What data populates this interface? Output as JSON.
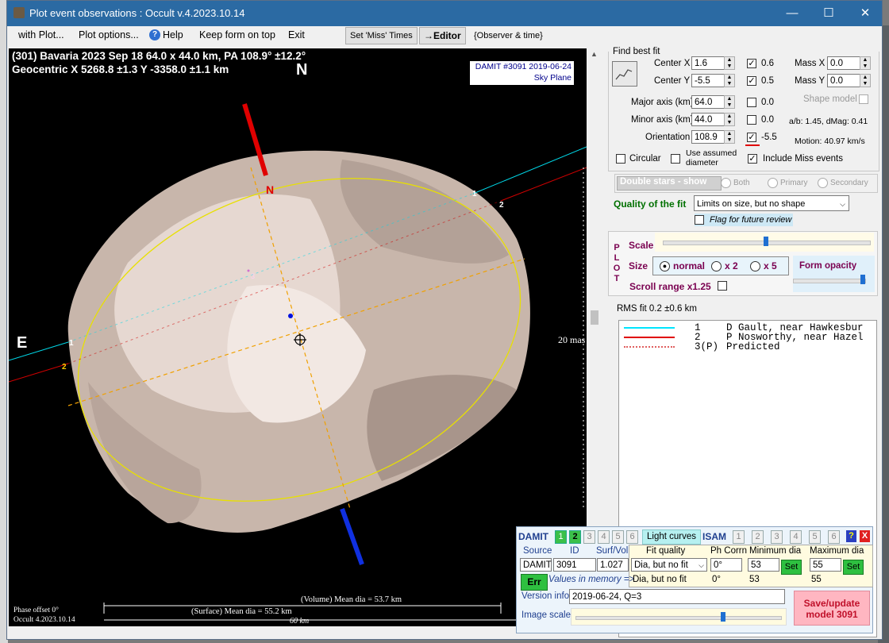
{
  "window": {
    "title": "Plot event observations : Occult v.4.2023.10.14",
    "buttons": {
      "minimize": "—",
      "maximize": "☐",
      "close": "✕"
    }
  },
  "menu": {
    "items": [
      "with Plot...",
      "Plot options...",
      "Help",
      "Keep form on top",
      "Exit"
    ],
    "set_miss_times": "Set 'Miss' Times",
    "editor": "→Editor",
    "observer_time": "{Observer & time}"
  },
  "plot": {
    "header_line1": "(301) Bavaria  2023 Sep 18   64.0 x 44.0 km, PA 108.9° ±12.2°",
    "header_line2": "Geocentric  X  5268.8 ±1.3  Y -3358.0 ±1.1 km",
    "north_big": "N",
    "north_axis": "N",
    "east": "E",
    "damit_label": "DAMIT #3091 2019-06-24",
    "sky_plane": "Sky Plane",
    "mas_label": "20 mas",
    "chord_labels": [
      "1",
      "2",
      "1",
      "2",
      "3"
    ],
    "volume_dia": "(Volume) Mean dia = 53.7 km",
    "surface_dia": "(Surface) Mean dia = 55.2 km",
    "scale_km": "60 km",
    "phase_offset": "Phase offset 0°",
    "version": "Occult 4.2023.10.14"
  },
  "fit": {
    "group_label": "Find best fit",
    "center_x_label": "Center X",
    "center_x": "1.6",
    "center_y_label": "Center Y",
    "center_y": "-5.5",
    "major_label": "Major axis (km)",
    "major": "64.0",
    "minor_label": "Minor axis (km)",
    "minor": "44.0",
    "orient_label": "Orientation",
    "orient": "108.9",
    "chk_vals": [
      "0.6",
      "0.5",
      "0.0",
      "0.0",
      "-5.5"
    ],
    "mass_x_label": "Mass X",
    "mass_x": "0.0",
    "mass_y_label": "Mass Y",
    "mass_y": "0.0",
    "shape_model": "Shape model",
    "ab_text": "a/b: 1.45, dMag: 0.41",
    "motion": "Motion: 40.97 km/s",
    "circular": "Circular",
    "use_assumed": "Use assumed diameter",
    "include_miss": "Include Miss events",
    "double_stars": "Double stars - show",
    "both": "Both",
    "primary": "Primary",
    "secondary": "Secondary",
    "quality_label": "Quality of the fit",
    "quality_value": "Limits on size, but no shape",
    "flag_review": "Flag for future review"
  },
  "plotctl": {
    "plot_letters": [
      "P",
      "L",
      "O",
      "T"
    ],
    "scale": "Scale",
    "size": "Size",
    "normal": "normal",
    "x2": "x 2",
    "x5": "x 5",
    "form_opacity": "Form opacity",
    "scroll_range": "Scroll range x1.25",
    "rms": "RMS fit 0.2 ±0.6 km",
    "scale_level": 0.5,
    "opacity_level": 0.98
  },
  "legend": [
    {
      "num": "1",
      "text": "D Gault, near Hawkesbur",
      "color": "#00e5ff",
      "style": "solid"
    },
    {
      "num": "2",
      "text": "P Nosworthy, near Hazel",
      "color": "#e00000",
      "style": "solid"
    },
    {
      "num": "3(P)",
      "text": "Predicted",
      "color": "#e06060",
      "style": "dotted"
    }
  ],
  "damit": {
    "damit": "DAMIT",
    "tabs": [
      "1",
      "2",
      "3",
      "4",
      "5",
      "6"
    ],
    "light_curves": "Light curves",
    "isam": "ISAM",
    "isam_tabs": [
      "1",
      "2",
      "3",
      "4",
      "5",
      "6"
    ],
    "help": "?",
    "close": "X",
    "source_label": "Source",
    "id_label": "ID",
    "surfvol_label": "Surf/Vol",
    "source": "DAMIT",
    "id": "3091",
    "surfvol": "1.027",
    "fit_quality_label": "Fit quality",
    "ph_corrn_label": "Ph Corrn",
    "min_dia_label": "Minimum dia",
    "max_dia_label": "Maximum dia",
    "fit_quality": "Dia, but no fit",
    "ph_corrn": "0°",
    "min_dia": "53",
    "max_dia": "55",
    "set": "Set",
    "err": "Err",
    "values_in_memory": "Values in memory =>",
    "mem_fit": "Dia, but no fit",
    "mem_ph": "0°",
    "mem_min": "53",
    "mem_max": "55",
    "version_label": "Version info",
    "version_value": "2019-06-24, Q=3",
    "image_scale": "Image scale",
    "image_scale_level": 0.72,
    "save_update": "Save/update model 3091"
  }
}
